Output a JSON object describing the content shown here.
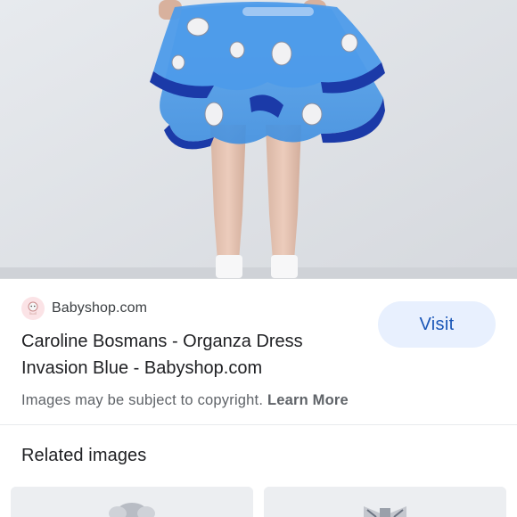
{
  "hero": {
    "image_description_icon": "skirt-photo"
  },
  "source": {
    "favicon_icon": "babyshop-logo-icon",
    "name": "Babyshop.com"
  },
  "visit_button": {
    "label": "Visit"
  },
  "title": {
    "line1": "Caroline Bosmans - Organza Dress",
    "line2": "Invasion Blue - Babyshop.com"
  },
  "copyright": {
    "text": "Images may be subject to copyright.",
    "link": "Learn More"
  },
  "related": {
    "heading": "Related images"
  },
  "colors": {
    "visit_bg": "#e8f0fe",
    "visit_text": "#1a56b7",
    "skirt_blue": "#3a8ee0",
    "skirt_dark": "#1b3aa8"
  }
}
